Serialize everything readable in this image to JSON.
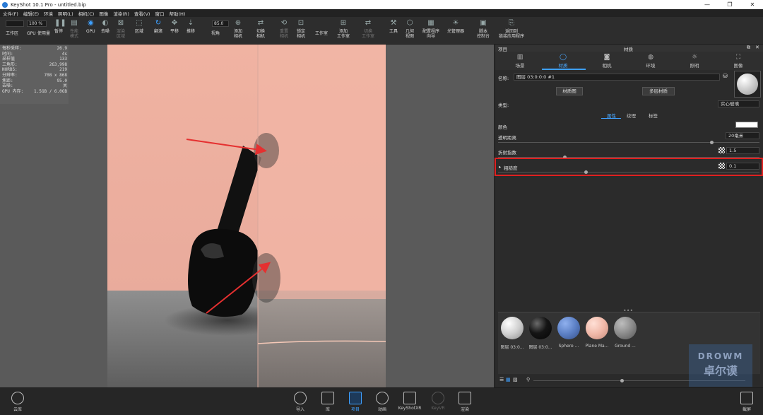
{
  "window": {
    "title": "KeyShot 10.1 Pro  - untitled.bip",
    "controls": [
      "—",
      "❐",
      "✕"
    ]
  },
  "menu": [
    "文件(F)",
    "编辑(E)",
    "环境",
    "照明(L)",
    "相机(C)",
    "图像",
    "渲染(R)",
    "查看(V)",
    "窗口",
    "帮助(H)"
  ],
  "toolbar": {
    "zoom_value": "100 %",
    "fov_value": "85.0",
    "items": [
      {
        "label": "工作区"
      },
      {
        "label": "GPU"
      },
      {
        "label": "使用量"
      },
      {
        "label": "暂停"
      },
      {
        "label": "性能\n模式"
      },
      {
        "label": "GPU"
      },
      {
        "label": "去噪"
      },
      {
        "label": "渲染\n区域"
      },
      {
        "label": "区域"
      },
      {
        "label": "翻滚"
      },
      {
        "label": "平移"
      },
      {
        "label": "推移"
      },
      {
        "label": "视角"
      },
      {
        "label": "添加\n相机"
      },
      {
        "label": "切换\n相机"
      },
      {
        "label": "重置\n相机"
      },
      {
        "label": "锁定\n相机"
      },
      {
        "label": "工作室"
      },
      {
        "label": "添加\n工作室"
      },
      {
        "label": "切换\n工作室"
      },
      {
        "label": "工具"
      },
      {
        "label": "几何\n视图"
      },
      {
        "label": "配置程序\n向导"
      },
      {
        "label": "光管理器"
      },
      {
        "label": "脚本\n控制台"
      },
      {
        "label": "返回到\n链接应用程序"
      }
    ]
  },
  "stats": [
    {
      "k": "每秒采样:",
      "v": "26.9"
    },
    {
      "k": "时间:",
      "v": "4s"
    },
    {
      "k": "采样值",
      "v": "133"
    },
    {
      "k": "三角形:",
      "v": "263,998"
    },
    {
      "k": "NURBS:",
      "v": "219"
    },
    {
      "k": "分辨率:",
      "v": "708 x 868"
    },
    {
      "k": "焦距:",
      "v": "95.0"
    },
    {
      "k": "去噪:",
      "v": "关"
    },
    {
      "k": "GPU 内存:",
      "v": "1.5GB / 6.0GB"
    }
  ],
  "panel": {
    "left_title": "项目",
    "title": "材质",
    "tabs": [
      {
        "label": "场景"
      },
      {
        "label": "材质"
      },
      {
        "label": "相机"
      },
      {
        "label": "环境"
      },
      {
        "label": "照明"
      },
      {
        "label": "图像"
      }
    ],
    "name_label": "名称:",
    "name_value": "图层 03:0:0:0 #1",
    "material_graph_btn": "材质图",
    "multi_material_btn": "多层材质",
    "type_label": "类型:",
    "type_value": "实心玻璃",
    "subtabs": [
      "属性",
      "纹理",
      "标签"
    ],
    "color_label": "颜色",
    "transparency_label": "透明距离",
    "transparency_value": "20毫米",
    "refraction_label": "折射指数",
    "refraction_value": "1.5",
    "roughness_label": "粗糙度",
    "roughness_value": "0.1"
  },
  "library": {
    "items": [
      {
        "label": "图层 03:0...",
        "color": "#d9d9d9"
      },
      {
        "label": "图层 03:0...",
        "color": "#1a1a1a"
      },
      {
        "label": "Sphere ...",
        "color": "#5b7fc4"
      },
      {
        "label": "Plane Ma...",
        "color": "#f0b8a8"
      },
      {
        "label": "Ground ...",
        "color": "#8a8a8a"
      }
    ]
  },
  "bottombar": {
    "cloud": "云库",
    "items": [
      "导入",
      "库",
      "项目",
      "动画",
      "KeyShotXR",
      "KeyVR",
      "渲染"
    ],
    "screenshot": "截屏"
  },
  "watermark": {
    "line1": "DROWM",
    "line2": "卓尔谟"
  }
}
